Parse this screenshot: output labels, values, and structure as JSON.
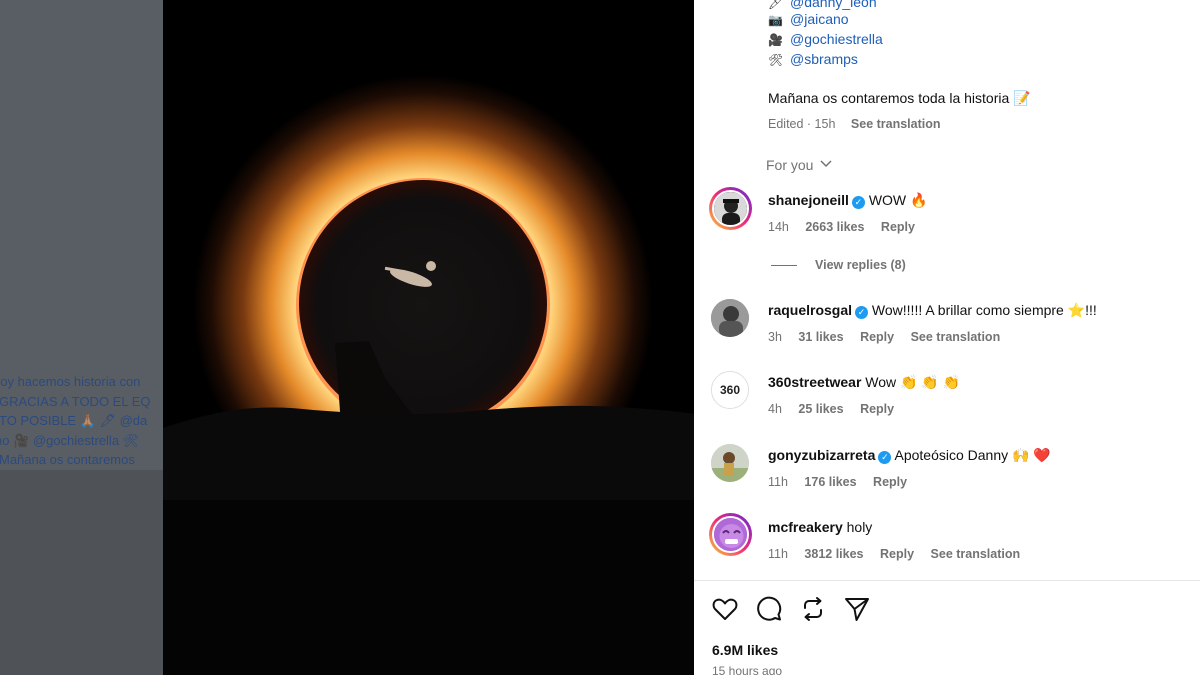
{
  "background_caption": {
    "lines": [
      "hoy hacemos historia con",
      "GRACIAS A TODO EL EQ",
      "TO POSIBLE 🙏🏽 🖊 @da",
      "no 🎥 @gochiestrella 🛠",
      "Mañana os contaremos"
    ]
  },
  "credits": [
    {
      "icon": "🖊",
      "icon_name": "pen-icon",
      "handle": "@danny_leon"
    },
    {
      "icon": "📷",
      "icon_name": "camera-icon",
      "handle": "@jaicano"
    },
    {
      "icon": "🎥",
      "icon_name": "video-camera-icon",
      "handle": "@gochiestrella"
    },
    {
      "icon": "🛠",
      "icon_name": "tools-icon",
      "handle": "@sbramps"
    }
  ],
  "caption": {
    "text": "Mañana os contaremos toda la historia",
    "emoji": "📝",
    "edited": "Edited · 15h",
    "see_translation": "See translation"
  },
  "filter": {
    "label": "For you",
    "icon": "chevron-down-icon"
  },
  "comments": [
    {
      "user": "shanejoneill",
      "verified": true,
      "text": "WOW 🔥",
      "time": "14h",
      "likes": "2663 likes",
      "reply": "Reply",
      "view_replies": "View replies (8)"
    },
    {
      "user": "raquelrosgal",
      "verified": true,
      "text": "Wow!!!!! A brillar como siempre ⭐️!!!",
      "time": "3h",
      "likes": "31 likes",
      "reply": "Reply",
      "see_translation": "See translation"
    },
    {
      "user": "360streetwear",
      "verified": false,
      "text": "Wow 👏 👏 👏",
      "time": "4h",
      "likes": "25 likes",
      "reply": "Reply"
    },
    {
      "user": "gonyzubizarreta",
      "verified": true,
      "text": "Apoteósico Danny 🙌 ❤️",
      "time": "11h",
      "likes": "176 likes",
      "reply": "Reply"
    },
    {
      "user": "mcfreakery",
      "verified": false,
      "text": "holy",
      "time": "11h",
      "likes": "3812 likes",
      "reply": "Reply",
      "see_translation": "See translation"
    }
  ],
  "actions": [
    "heart-icon",
    "comment-icon",
    "repost-icon",
    "share-icon"
  ],
  "post": {
    "likes": "6.9M likes",
    "posted": "15 hours ago"
  },
  "colors": {
    "link": "#1e5fb8",
    "muted": "#737373",
    "verified": "#1d9bf0"
  }
}
